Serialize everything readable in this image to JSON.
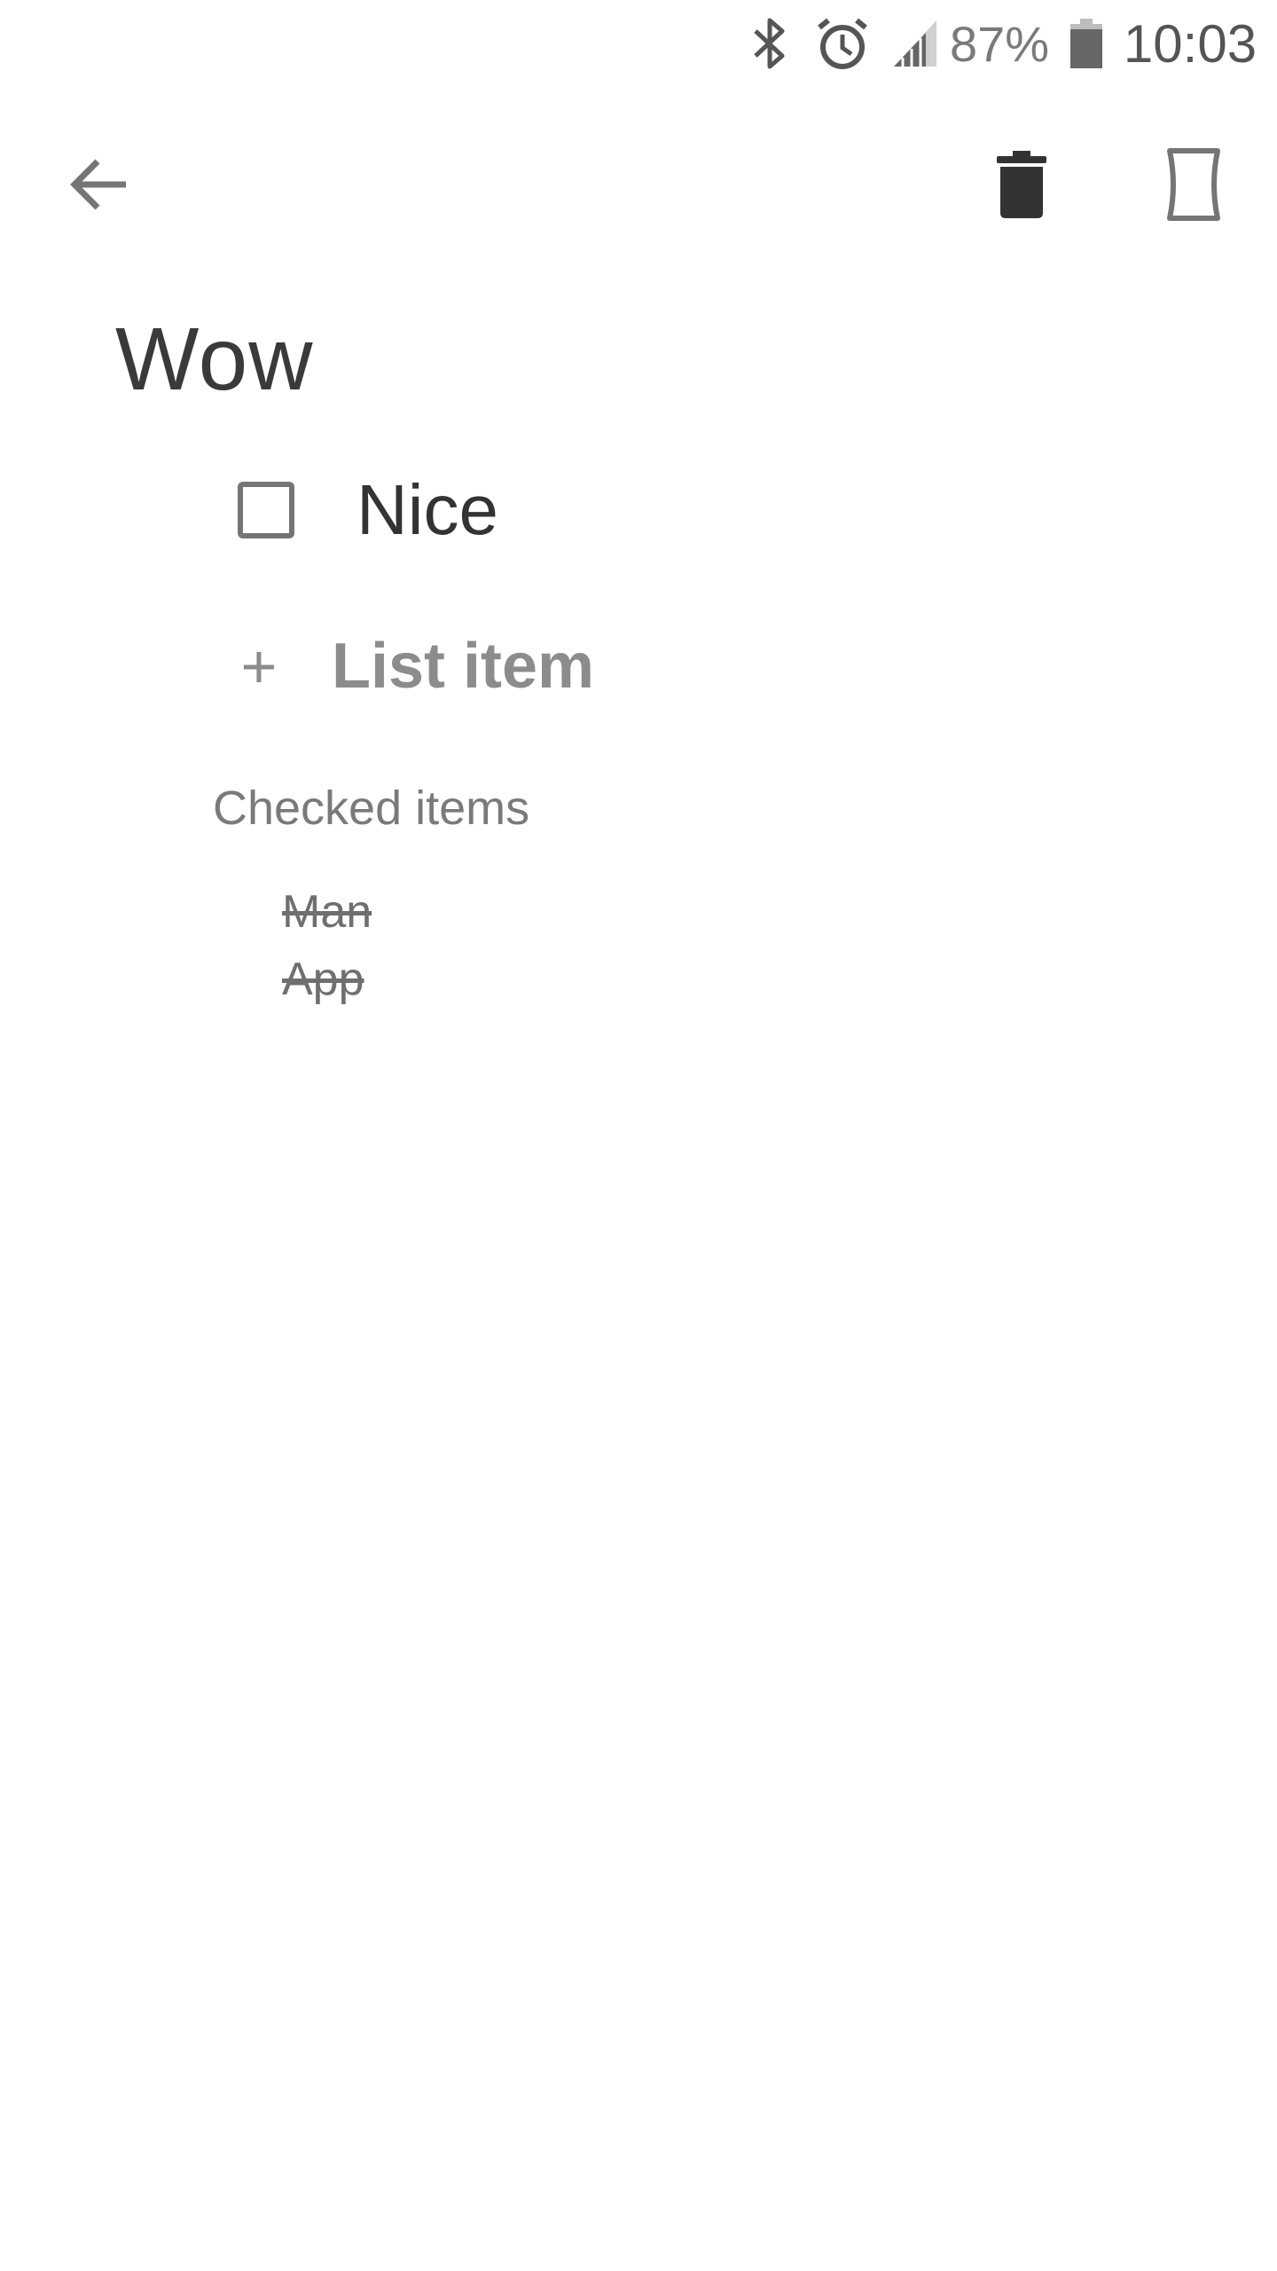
{
  "status_bar": {
    "battery_percent": "87%",
    "time": "10:03",
    "icons": [
      "bluetooth-icon",
      "alarm-icon",
      "signal-icon",
      "battery-icon"
    ]
  },
  "toolbar": {
    "icons": [
      "back-arrow-icon",
      "trash-icon",
      "cast-icon"
    ]
  },
  "note": {
    "title": "Wow",
    "items": [
      {
        "label": "Nice",
        "checked": false
      }
    ],
    "add_item_label": "List item",
    "add_item_symbol": "+",
    "checked_header": "Checked items",
    "checked_items": [
      "Man",
      "App"
    ]
  },
  "colors": {
    "text_primary": "#333333",
    "text_secondary": "#7a7a7a",
    "icon_dark": "#333333",
    "icon_grey": "#757575",
    "background": "#ffffff"
  }
}
